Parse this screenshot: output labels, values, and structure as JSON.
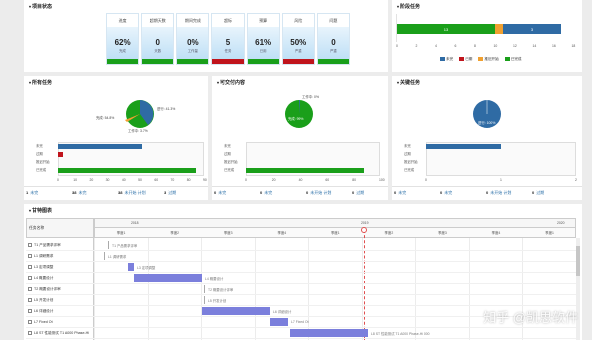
{
  "sections": {
    "project_status": "项目状态",
    "milestones": "阶段任务",
    "all_tasks": "所有任务",
    "deliverables": "可交付内容",
    "key_tasks": "关键任务",
    "gantt": "甘特图表"
  },
  "status_cards": [
    {
      "label": "进度",
      "value": "62%",
      "sub": "完成"
    },
    {
      "label": "超期天数",
      "value": "0",
      "sub": "天数"
    },
    {
      "label": "期间完成",
      "value": "0%",
      "sub": "工作量"
    },
    {
      "label": "超标",
      "value": "5",
      "sub": "任务"
    },
    {
      "label": "预算",
      "value": "61%",
      "sub": "已用"
    },
    {
      "label": "风险",
      "value": "50%",
      "sub": "严重"
    },
    {
      "label": "问题",
      "value": "0",
      "sub": "严重"
    }
  ],
  "colors": {
    "blue": "#2f6ba4",
    "green": "#1a9f1a",
    "red": "#c0141c",
    "orange": "#f0a030",
    "status_bars": [
      "#1a9f1a",
      "#1a9f1a",
      "#1a9f1a",
      "#c0141c",
      "#1a9f1a",
      "#c0141c",
      "#1a9f1a"
    ]
  },
  "milestone_chart": {
    "segments": [
      {
        "value": "13",
        "color": "#1a9f1a"
      },
      {
        "value": "",
        "color": "#f0a030"
      },
      {
        "value": "3",
        "color": "#2f6ba4"
      }
    ],
    "axis": [
      "0",
      "2",
      "4",
      "6",
      "8",
      "10",
      "12",
      "14",
      "16",
      "18"
    ],
    "legend": [
      {
        "name": "未完",
        "color": "#2f6ba4"
      },
      {
        "name": "已期",
        "color": "#c0141c"
      },
      {
        "name": "推迟开始",
        "color": "#f0a030"
      },
      {
        "name": "已完成",
        "color": "#1a9f1a"
      }
    ]
  },
  "all_tasks": {
    "pie_labels": [
      "进行: 41.3%",
      "完成: 54.8%",
      "工作中: 3.7%"
    ],
    "rows": [
      "未完",
      "过期",
      "推迟开始",
      "已完成"
    ],
    "axis": [
      "0",
      "10",
      "20",
      "30",
      "40",
      "50",
      "60",
      "70",
      "80",
      "90"
    ],
    "counts": [
      {
        "n": "1",
        "t": "未完"
      },
      {
        "n": "38",
        "t": "未完"
      },
      {
        "n": "38",
        "t": "未开始 计划"
      },
      {
        "n": "3",
        "t": "过期"
      }
    ],
    "chart_data": {
      "type": "bar",
      "categories": [
        "未完",
        "过期",
        "推迟开始",
        "已完成"
      ],
      "values": [
        52,
        3,
        0,
        85
      ],
      "xlim": [
        0,
        90
      ]
    }
  },
  "deliverables": {
    "pie_labels": [
      "工作中: 0%",
      "完成: 99%"
    ],
    "rows": [
      "未完",
      "过期",
      "推迟开始",
      "已完成"
    ],
    "axis": [
      "0",
      "20",
      "40",
      "60",
      "80",
      "100"
    ],
    "counts": [
      {
        "n": "0",
        "t": "未完"
      },
      {
        "n": "0",
        "t": "未完"
      },
      {
        "n": "0",
        "t": "未开始 计划"
      },
      {
        "n": "0",
        "t": "过期"
      }
    ],
    "chart_data": {
      "type": "bar",
      "categories": [
        "未完",
        "过期",
        "推迟开始",
        "已完成"
      ],
      "values": [
        0,
        0,
        0,
        88
      ],
      "xlim": [
        0,
        100
      ]
    }
  },
  "key_tasks": {
    "pie_labels": [
      "进行: 100%"
    ],
    "rows": [
      "未完",
      "过期",
      "推迟开始",
      "已完成"
    ],
    "axis": [
      "0",
      "1",
      "2"
    ],
    "counts": [
      {
        "n": "0",
        "t": "未完"
      },
      {
        "n": "0",
        "t": "未完"
      },
      {
        "n": "0",
        "t": "未开始 计划"
      },
      {
        "n": "0",
        "t": "过期"
      }
    ],
    "chart_data": {
      "type": "bar",
      "categories": [
        "未完",
        "过期",
        "推迟开始",
        "已完成"
      ],
      "values": [
        1,
        0,
        0,
        0
      ],
      "xlim": [
        0,
        2
      ]
    }
  },
  "gantt": {
    "name_header": "任务名称",
    "years": [
      "2018",
      "2019",
      "2020"
    ],
    "quarters": [
      "季度1",
      "季度2",
      "季度3",
      "季度4",
      "季度1",
      "季度2",
      "季度3",
      "季度4",
      "季度1"
    ],
    "rows": [
      {
        "name": "T1 产品需求评审",
        "caption": "T1 产品需求评审"
      },
      {
        "name": "L1 调研需求",
        "caption": "L1 调研需求"
      },
      {
        "name": "L3 定项调整",
        "caption": "L3 定项调整"
      },
      {
        "name": "L4 概要设计",
        "caption": "L4 概要设计"
      },
      {
        "name": "T2 概要设计评审",
        "caption": "T2 概要设计评审"
      },
      {
        "name": "L5 开发计划",
        "caption": "L5 开发计划"
      },
      {
        "name": "L6 详细设计",
        "caption": "L6 详细设计"
      },
      {
        "name": "L7 Fixed Ot",
        "caption": "L7 Fixed Ot"
      },
      {
        "name": "L8 ST 性能测试 T1 A000 Phase-Hi",
        "caption": "L8 ST 性能测试 T1 A000 Phase-Hi 000"
      }
    ]
  },
  "watermark": "知乎 @凯思软件"
}
